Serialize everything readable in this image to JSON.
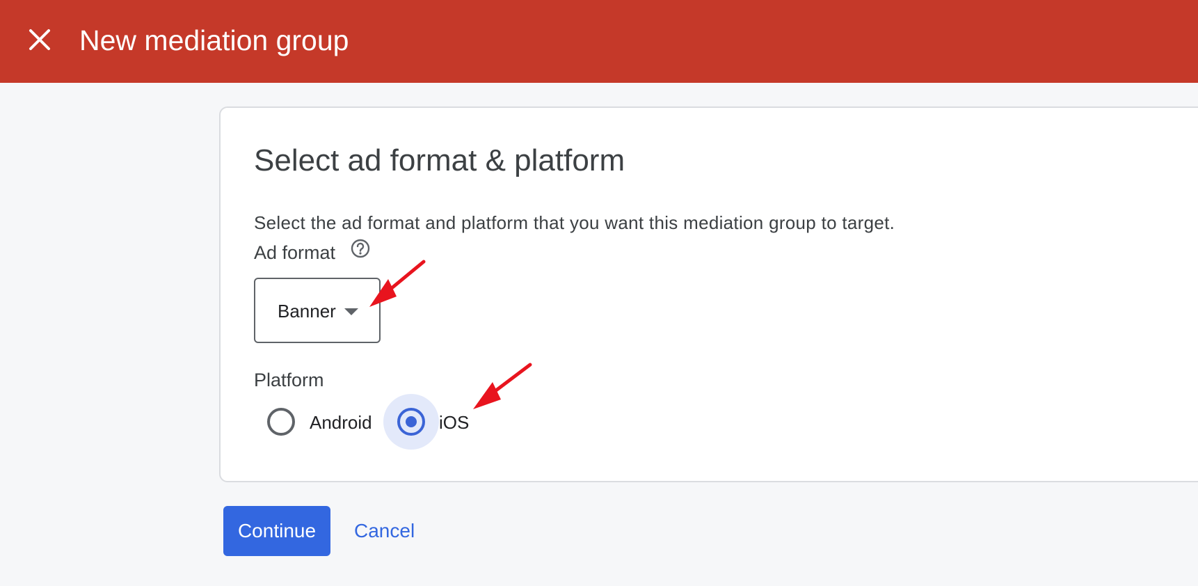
{
  "header": {
    "title": "New mediation group",
    "close_icon": "close-icon",
    "background": "#c53929"
  },
  "card": {
    "title": "Select ad format & platform",
    "description": "Select the ad format and platform that you want this mediation group to target.",
    "ad_format": {
      "label": "Ad format",
      "help_icon": "help-circle-icon",
      "selected": "Banner"
    },
    "platform": {
      "label": "Platform",
      "options": [
        {
          "label": "Android",
          "selected": false
        },
        {
          "label": "iOS",
          "selected": true
        }
      ]
    }
  },
  "actions": {
    "continue_label": "Continue",
    "cancel_label": "Cancel"
  },
  "colors": {
    "accent": "#3367e0",
    "annotation_arrow": "#e8141e"
  }
}
